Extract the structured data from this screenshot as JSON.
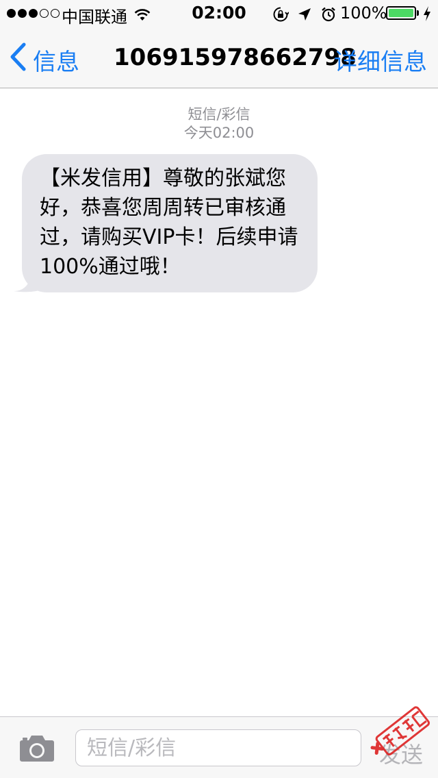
{
  "status_bar": {
    "carrier": "中国联通",
    "time": "02:00",
    "battery_percent": "100%",
    "battery_level": 1.0,
    "battery_color": "#4cd964",
    "signal_bars_filled": 3,
    "signal_bars_total": 5,
    "icons": [
      "wifi-icon",
      "rotation-lock-icon",
      "location-arrow-icon",
      "alarm-icon",
      "charging-bolt-icon"
    ]
  },
  "nav": {
    "back_label": "信息",
    "title": "106915978662798",
    "details_label": "详细信息",
    "accent_color": "#1a7ef3"
  },
  "conversation": {
    "service_label": "短信/彩信",
    "timestamp": "今天02:00",
    "messages": [
      {
        "direction": "incoming",
        "text": "【米发信用】尊敬的张斌您好，恭喜您周周转已审核通过，请购买VIP卡！后续申请100%通过哦！"
      }
    ]
  },
  "input_bar": {
    "placeholder": "短信/彩信",
    "send_label": "发送"
  },
  "watermark": {
    "text": "卡农社区"
  }
}
